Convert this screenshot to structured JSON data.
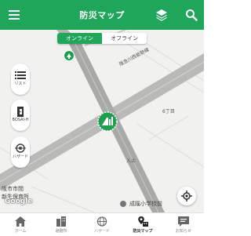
{
  "header": {
    "title": "防災マップ"
  },
  "segment": {
    "online": "オンライン",
    "offline": "オフライン"
  },
  "side_buttons": [
    {
      "label": "リスト",
      "icon": "list-icon"
    },
    {
      "label": "BOSAI-H",
      "icon": "exit-door-icon"
    },
    {
      "label": "ハザード",
      "icon": "hazard-icon"
    }
  ],
  "map_labels": {
    "road": "阪急川西能勢線",
    "chome": "6丁目",
    "crossing": "入止",
    "place1": "阪市市間",
    "place2": "新生保育所",
    "poi": "成蹊小学校前"
  },
  "attribution": "Google",
  "tabs": [
    {
      "label": "ホーム",
      "icon": "home-icon",
      "active": false
    },
    {
      "label": "避難所",
      "icon": "shelter-icon",
      "active": false
    },
    {
      "label": "ハザード",
      "icon": "globe-icon",
      "active": false
    },
    {
      "label": "防災マップ",
      "icon": "disaster-map-icon",
      "active": true
    },
    {
      "label": "お知らせ",
      "icon": "message-icon",
      "active": false
    }
  ],
  "colors": {
    "primary": "#20a65a",
    "marker": "#1e9e4f"
  }
}
